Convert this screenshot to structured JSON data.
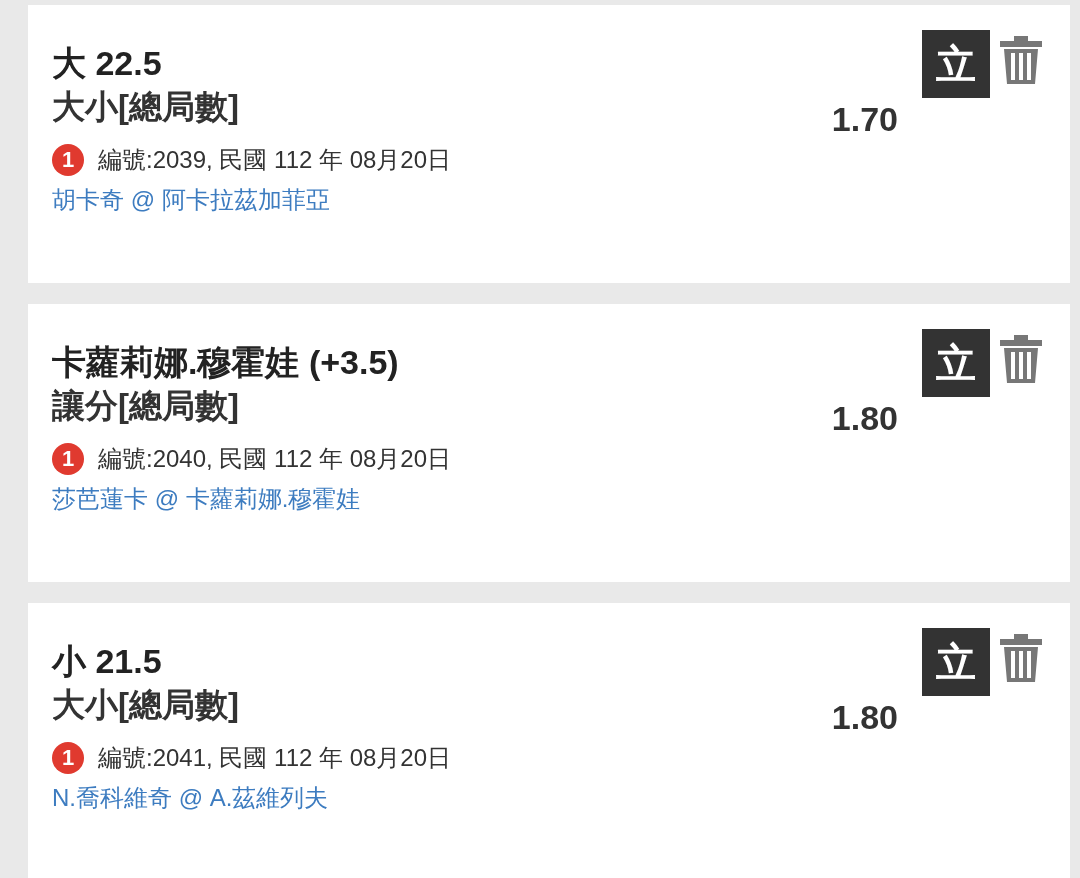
{
  "bets": [
    {
      "selection": "大 22.5",
      "market": "大小[總局數]",
      "odds": "1.70",
      "badge": "1",
      "info": "編號:2039, 民國 112 年 08月20日",
      "match": "胡卡奇 @ 阿卡拉茲加菲亞",
      "action": "立"
    },
    {
      "selection": "卡蘿莉娜.穆霍娃 (+3.5)",
      "market": "讓分[總局數]",
      "odds": "1.80",
      "badge": "1",
      "info": "編號:2040, 民國 112 年 08月20日",
      "match": "莎芭蓮卡 @ 卡蘿莉娜.穆霍娃",
      "action": "立"
    },
    {
      "selection": "小 21.5",
      "market": "大小[總局數]",
      "odds": "1.80",
      "badge": "1",
      "info": "編號:2041, 民國 112 年 08月20日",
      "match": "N.喬科維奇 @ A.茲維列夫",
      "action": "立"
    }
  ]
}
